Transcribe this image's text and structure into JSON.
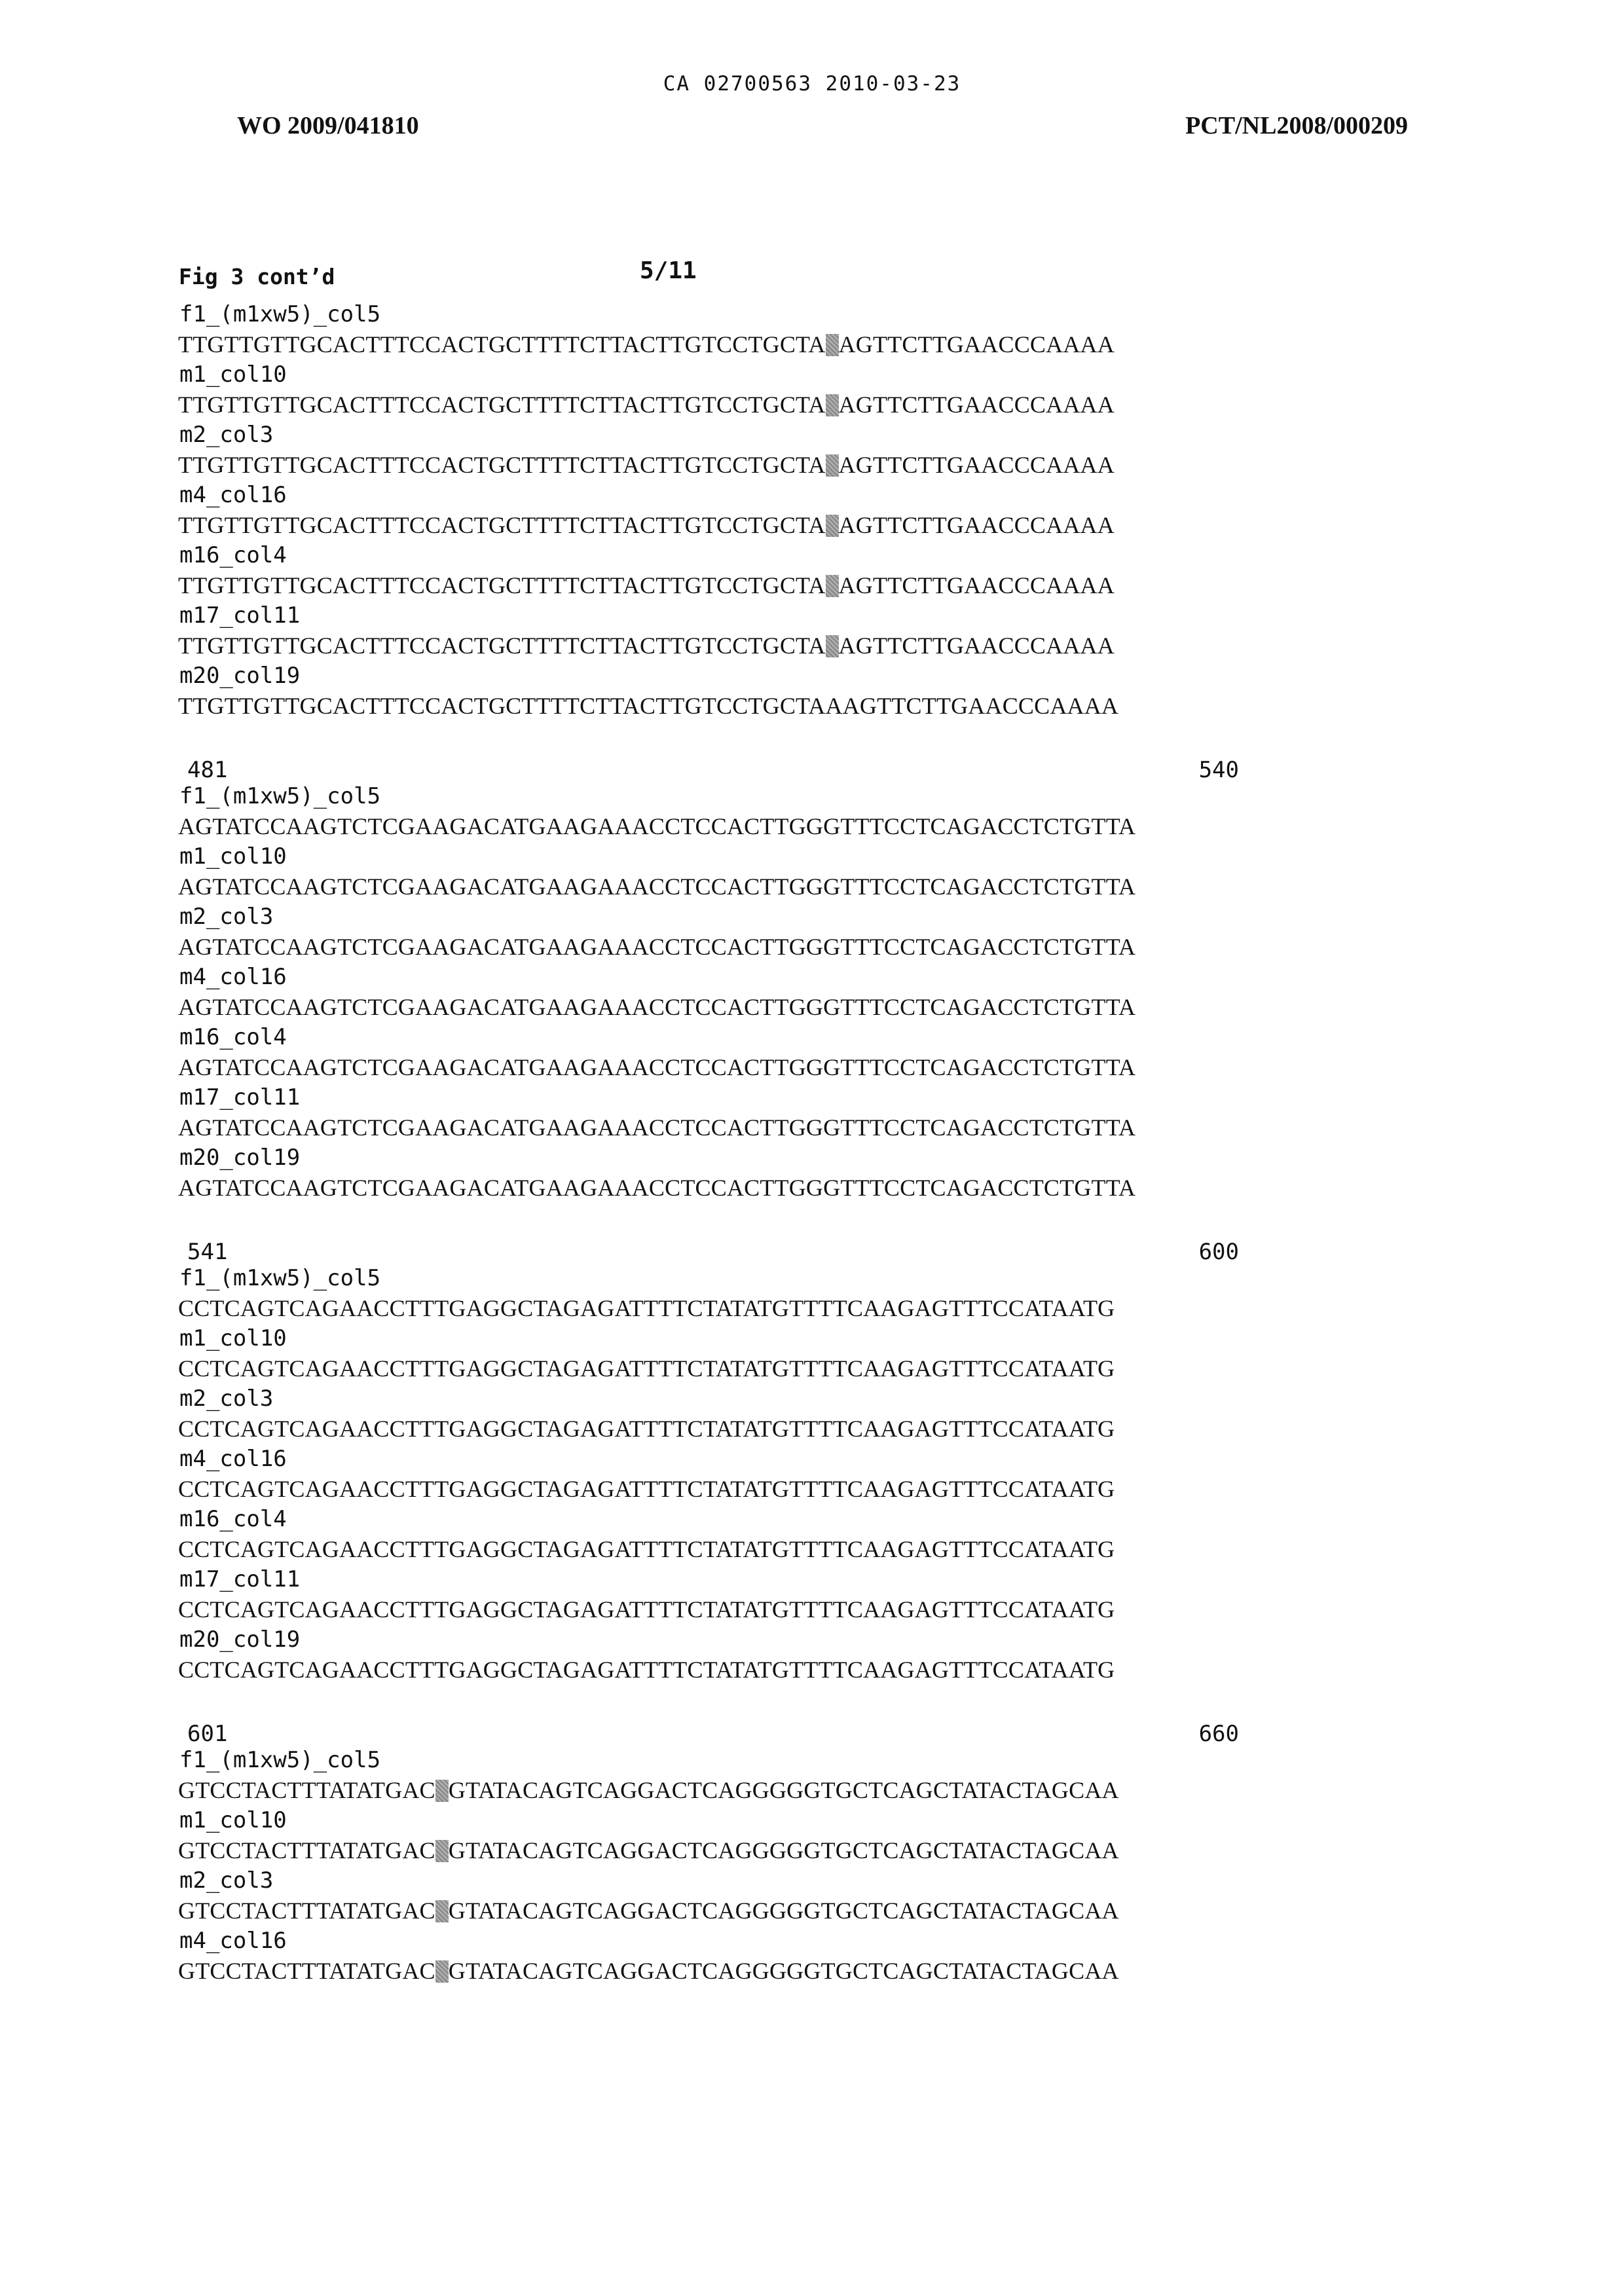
{
  "header": {
    "ca_line": "CA 02700563 2010-03-23",
    "wo_number": "WO 2009/041810",
    "pct_number": "PCT/NL2008/000209"
  },
  "figure": {
    "title": "Fig 3 cont’d",
    "page": "5/11"
  },
  "blocks": [
    {
      "start": "",
      "end": "",
      "rows": [
        {
          "label": "f1_(m1xw5)_col5",
          "seq_a": "TTGTTGTTGCACTTTCCACTGCTTTTCTTACTTGTCCTGCTA",
          "seq_b": "AGTTCTTGAACCCAAAA"
        },
        {
          "label": "m1_col10",
          "seq_a": "TTGTTGTTGCACTTTCCACTGCTTTTCTTACTTGTCCTGCTA",
          "seq_b": "AGTTCTTGAACCCAAAA"
        },
        {
          "label": "m2_col3",
          "seq_a": "TTGTTGTTGCACTTTCCACTGCTTTTCTTACTTGTCCTGCTA",
          "seq_b": "AGTTCTTGAACCCAAAA"
        },
        {
          "label": "m4_col16",
          "seq_a": "TTGTTGTTGCACTTTCCACTGCTTTTCTTACTTGTCCTGCTA",
          "seq_b": "AGTTCTTGAACCCAAAA"
        },
        {
          "label": "m16_col4",
          "seq_a": "TTGTTGTTGCACTTTCCACTGCTTTTCTTACTTGTCCTGCTA",
          "seq_b": "AGTTCTTGAACCCAAAA"
        },
        {
          "label": "m17_col11",
          "seq_a": "TTGTTGTTGCACTTTCCACTGCTTTTCTTACTTGTCCTGCTA",
          "seq_b": "AGTTCTTGAACCCAAAA"
        },
        {
          "label": "m20_col19",
          "seq_a": "TTGTTGTTGCACTTTCCACTGCTTTTCTTACTTGTCCTGCTAAAGTTCTTGAACCCAAAA",
          "seq_b": ""
        }
      ]
    },
    {
      "start": "481",
      "end": "540",
      "rows": [
        {
          "label": "f1_(m1xw5)_col5",
          "seq": "AGTATCCAAGTCTCGAAGACATGAAGAAACCTCCACTTGGGTTTCCTCAGACCTCTGTTA"
        },
        {
          "label": "m1_col10",
          "seq": "AGTATCCAAGTCTCGAAGACATGAAGAAACCTCCACTTGGGTTTCCTCAGACCTCTGTTA"
        },
        {
          "label": "m2_col3",
          "seq": "AGTATCCAAGTCTCGAAGACATGAAGAAACCTCCACTTGGGTTTCCTCAGACCTCTGTTA"
        },
        {
          "label": "m4_col16",
          "seq": "AGTATCCAAGTCTCGAAGACATGAAGAAACCTCCACTTGGGTTTCCTCAGACCTCTGTTA"
        },
        {
          "label": "m16_col4",
          "seq": "AGTATCCAAGTCTCGAAGACATGAAGAAACCTCCACTTGGGTTTCCTCAGACCTCTGTTA"
        },
        {
          "label": "m17_col11",
          "seq": "AGTATCCAAGTCTCGAAGACATGAAGAAACCTCCACTTGGGTTTCCTCAGACCTCTGTTA"
        },
        {
          "label": "m20_col19",
          "seq": "AGTATCCAAGTCTCGAAGACATGAAGAAACCTCCACTTGGGTTTCCTCAGACCTCTGTTA"
        }
      ]
    },
    {
      "start": "541",
      "end": "600",
      "rows": [
        {
          "label": "f1_(m1xw5)_col5",
          "seq": "CCTCAGTCAGAACCTTTGAGGCTAGAGATTTTCTATATGTTTTCAAGAGTTTCCATAATG"
        },
        {
          "label": "m1_col10",
          "seq": "CCTCAGTCAGAACCTTTGAGGCTAGAGATTTTCTATATGTTTTCAAGAGTTTCCATAATG"
        },
        {
          "label": "m2_col3",
          "seq": "CCTCAGTCAGAACCTTTGAGGCTAGAGATTTTCTATATGTTTTCAAGAGTTTCCATAATG"
        },
        {
          "label": "m4_col16",
          "seq": "CCTCAGTCAGAACCTTTGAGGCTAGAGATTTTCTATATGTTTTCAAGAGTTTCCATAATG"
        },
        {
          "label": "m16_col4",
          "seq": "CCTCAGTCAGAACCTTTGAGGCTAGAGATTTTCTATATGTTTTCAAGAGTTTCCATAATG"
        },
        {
          "label": "m17_col11",
          "seq": "CCTCAGTCAGAACCTTTGAGGCTAGAGATTTTCTATATGTTTTCAAGAGTTTCCATAATG"
        },
        {
          "label": "m20_col19",
          "seq": "CCTCAGTCAGAACCTTTGAGGCTAGAGATTTTCTATATGTTTTCAAGAGTTTCCATAATG"
        }
      ]
    },
    {
      "start": "601",
      "end": "660",
      "rows": [
        {
          "label": "f1_(m1xw5)_col5",
          "seq_a": "GTCCTACTTTATATGAC",
          "seq_b": "GTATACAGTCAGGACTCAGGGGGTGCTCAGCTATACTAGCAA"
        },
        {
          "label": "m1_col10",
          "seq_a": "GTCCTACTTTATATGAC",
          "seq_b": "GTATACAGTCAGGACTCAGGGGGTGCTCAGCTATACTAGCAA"
        },
        {
          "label": "m2_col3",
          "seq_a": "GTCCTACTTTATATGAC",
          "seq_b": "GTATACAGTCAGGACTCAGGGGGTGCTCAGCTATACTAGCAA"
        },
        {
          "label": "m4_col16",
          "seq_a": "GTCCTACTTTATATGAC",
          "seq_b": "GTATACAGTCAGGACTCAGGGGGTGCTCAGCTATACTAGCAA"
        }
      ]
    }
  ]
}
